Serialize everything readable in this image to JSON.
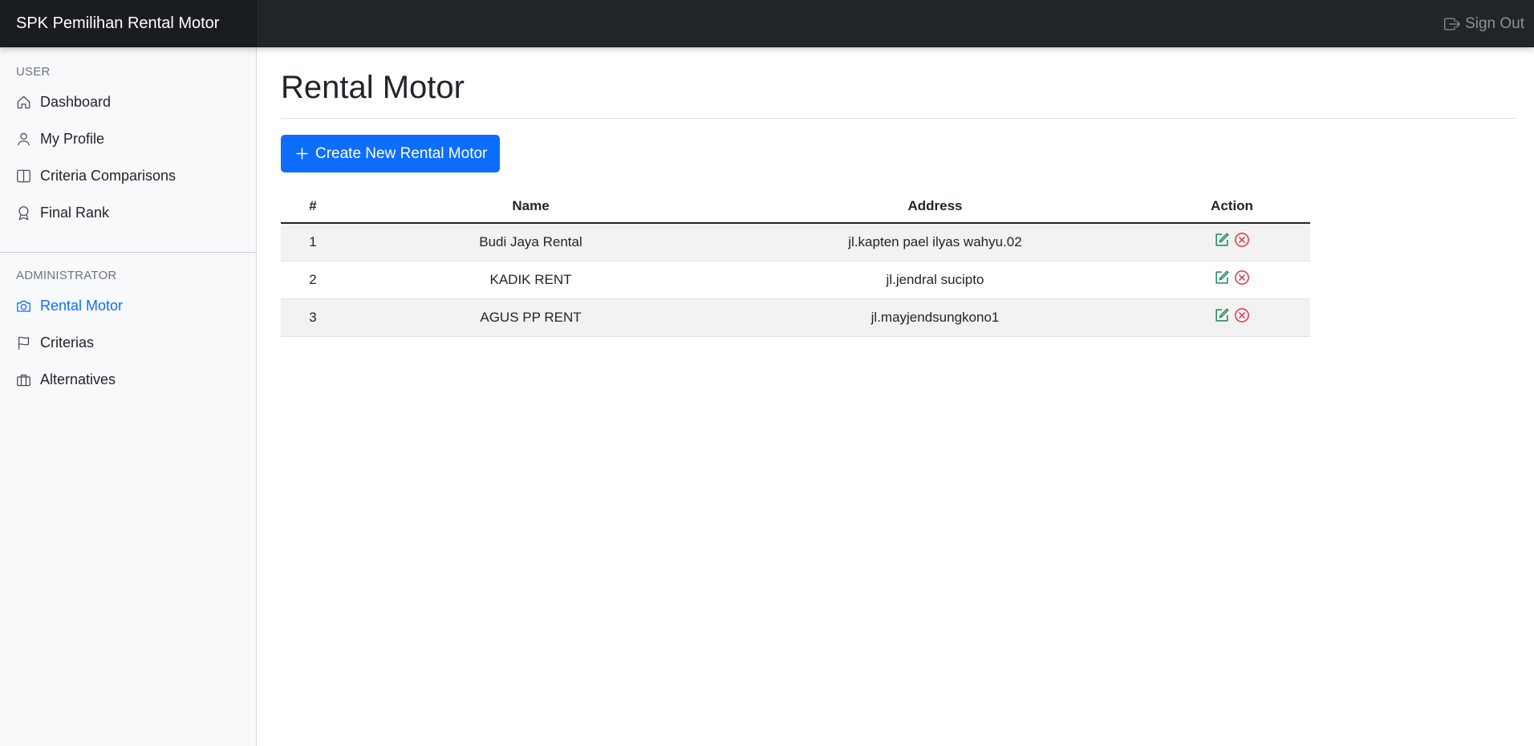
{
  "app": {
    "brand": "SPK Pemilihan Rental Motor",
    "signout_label": "Sign Out"
  },
  "sidebar": {
    "user_heading": "USER",
    "user_items": [
      {
        "label": "Dashboard",
        "icon": "house-icon"
      },
      {
        "label": "My Profile",
        "icon": "person-icon"
      },
      {
        "label": "Criteria Comparisons",
        "icon": "layout-split-icon"
      },
      {
        "label": "Final Rank",
        "icon": "award-icon"
      }
    ],
    "admin_heading": "ADMINISTRATOR",
    "admin_items": [
      {
        "label": "Rental Motor",
        "icon": "camera-icon",
        "active": true
      },
      {
        "label": "Criterias",
        "icon": "flag-icon"
      },
      {
        "label": "Alternatives",
        "icon": "briefcase-icon"
      }
    ]
  },
  "main": {
    "title": "Rental Motor",
    "create_label": "Create New Rental Motor",
    "table": {
      "headers": [
        "#",
        "Name",
        "Address",
        "Action"
      ],
      "rows": [
        {
          "no": "1",
          "name": "Budi Jaya Rental",
          "address": "jl.kapten pael ilyas wahyu.02"
        },
        {
          "no": "2",
          "name": "KADIK RENT",
          "address": "jl.jendral sucipto"
        },
        {
          "no": "3",
          "name": "AGUS PP RENT",
          "address": "jl.mayjendsungkono1"
        }
      ]
    }
  },
  "colors": {
    "primary": "#0d6efd",
    "topbar": "#212529",
    "edit": "#198754",
    "delete": "#dc3545"
  }
}
